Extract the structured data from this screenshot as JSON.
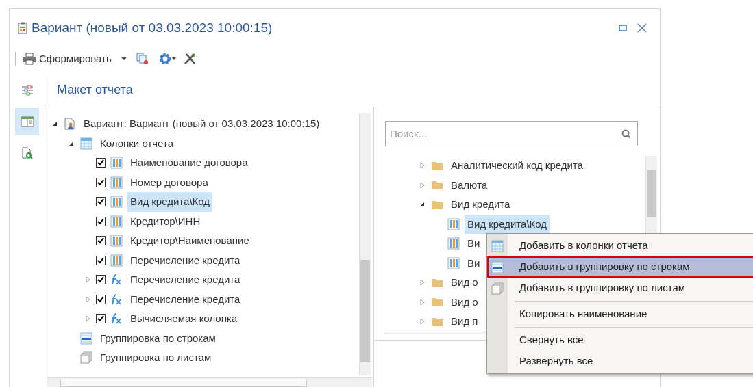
{
  "window": {
    "title": "Вариант (новый от 03.03.2023 10:00:15)"
  },
  "toolbar": {
    "generate_label": "Сформировать"
  },
  "side_tabs": [
    {
      "kind": "settings",
      "selected": false
    },
    {
      "kind": "layout",
      "selected": true
    },
    {
      "kind": "preview",
      "selected": false
    }
  ],
  "panel": {
    "title": "Макет отчета"
  },
  "layout_tree": [
    {
      "label": "Вариант: Вариант (новый от 03.03.2023 10:00:15)",
      "kind": "variant",
      "expanded": true,
      "selected": false,
      "children": [
        {
          "label": "Колонки отчета",
          "kind": "table",
          "expanded": true,
          "selected": false,
          "children": [
            {
              "label": "Наименование договора",
              "kind": "column",
              "checked": true,
              "selected": false
            },
            {
              "label": "Номер договора",
              "kind": "column",
              "checked": true,
              "selected": false
            },
            {
              "label": "Вид кредита\\Код",
              "kind": "column",
              "checked": true,
              "selected": true
            },
            {
              "label": "Кредитор\\ИНН",
              "kind": "column",
              "checked": true,
              "selected": false
            },
            {
              "label": "Кредитор\\Наименование",
              "kind": "column",
              "checked": true,
              "selected": false
            },
            {
              "label": "Перечисление кредита",
              "kind": "column",
              "checked": true,
              "selected": false
            },
            {
              "label": "Перечисление кредита",
              "kind": "formula",
              "checked": true,
              "expanded": false,
              "selected": false
            },
            {
              "label": "Перечисление кредита",
              "kind": "formula",
              "checked": true,
              "expanded": false,
              "selected": false
            },
            {
              "label": "Вычисляемая колонка",
              "kind": "formula",
              "checked": true,
              "expanded": false,
              "selected": false
            }
          ]
        },
        {
          "label": "Группировка по строкам",
          "kind": "rows",
          "selected": false
        },
        {
          "label": "Группировка по листам",
          "kind": "sheets",
          "selected": false
        }
      ]
    }
  ],
  "search": {
    "placeholder": "Поиск..."
  },
  "fields_tree": [
    {
      "label": "Аналитический код кредита",
      "kind": "folder",
      "expanded": false,
      "selected": false
    },
    {
      "label": "Валюта",
      "kind": "folder",
      "expanded": false,
      "selected": false
    },
    {
      "label": "Вид кредита",
      "kind": "folder",
      "expanded": true,
      "selected": false,
      "children": [
        {
          "label": "Вид кредита\\Код",
          "kind": "column",
          "selected": true
        },
        {
          "label": "Ви",
          "kind": "column",
          "selected": false
        },
        {
          "label": "Ви",
          "kind": "column",
          "selected": false
        }
      ]
    },
    {
      "label": "Вид о",
      "kind": "folder",
      "expanded": false,
      "selected": false
    },
    {
      "label": "Вид о",
      "kind": "folder",
      "expanded": false,
      "selected": false
    },
    {
      "label": "Вид п",
      "kind": "folder",
      "expanded": false,
      "selected": false
    }
  ],
  "context_menu": [
    {
      "label": "Добавить в колонки отчета",
      "kind": "table",
      "selected": false,
      "separator_before": false
    },
    {
      "label": "Добавить в группировку по строкам",
      "kind": "rows",
      "selected": true,
      "separator_before": false
    },
    {
      "label": "Добавить в группировку по листам",
      "kind": "sheets",
      "selected": false,
      "separator_before": false
    },
    {
      "label": "Копировать наименование",
      "kind": "none",
      "selected": false,
      "separator_before": true
    },
    {
      "label": "Свернуть все",
      "kind": "none",
      "selected": false,
      "separator_before": true
    },
    {
      "label": "Развернуть все",
      "kind": "none",
      "selected": false,
      "separator_before": false
    }
  ]
}
